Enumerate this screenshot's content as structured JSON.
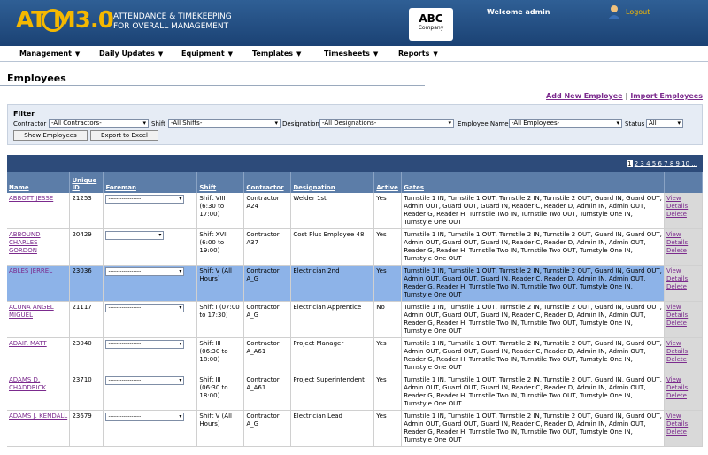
{
  "header": {
    "logo_text": "AT  M3.0",
    "tagline_line1": "ATTENDANCE & TIMEKEEPING",
    "tagline_line2": "FOR OVERALL MANAGEMENT",
    "company_name": "ABC",
    "company_sub": "Company",
    "welcome": "Welcome admin",
    "logout": "Logout"
  },
  "menu": [
    {
      "label": "Management"
    },
    {
      "label": "Daily Updates"
    },
    {
      "label": "Equipment"
    },
    {
      "label": "Templates"
    },
    {
      "label": "Timesheets"
    },
    {
      "label": "Reports"
    }
  ],
  "page_title": "Employees",
  "links": {
    "add": "Add New Employee",
    "sep": "|",
    "import": "Import Employees"
  },
  "filter": {
    "title": "Filter",
    "contractor_label": "Contractor",
    "contractor_value": "-All Contractors-",
    "shift_label": "Shift",
    "shift_value": "-All Shifts-",
    "designation_label": "Designation",
    "designation_value": "-All Designations-",
    "employee_label": "Employee Name",
    "employee_value": "-All Employees-",
    "status_label": "Status",
    "status_value": "All",
    "show_btn": "Show Employees",
    "export_btn": "Export to Excel"
  },
  "pager": {
    "current": "1",
    "pages": "2 3 4 5 6 7 8 9 10 ..."
  },
  "columns": [
    "Name",
    "Unique ID",
    "Foreman",
    "Shift",
    "Contractor",
    "Designation",
    "Active",
    "Gates",
    ""
  ],
  "foreman_value": "-----------------",
  "gates_text": "Turnstile 1 IN, Turnstile 1 OUT, Turnstile 2 IN, Turnstile 2 OUT, Guard IN, Guard OUT, Admin OUT, Guard OUT, Guard IN, Reader C, Reader D, Admin IN, Admin OUT, Reader G, Reader H, Turnstile Two IN, Turnstile Two OUT, Turnstyle One IN, Turnstyle One OUT",
  "actions": {
    "view": "View",
    "details": "Details",
    "delete": "Delete"
  },
  "rows": [
    {
      "name": "ABBOTT JESSE",
      "id": "21253",
      "shift": "Shift VIII (6:30 to 17:00)",
      "contractor": "Contractor A24",
      "designation": "Welder 1st",
      "active": "Yes"
    },
    {
      "name": "ABBOUND CHARLES GORDON",
      "id": "20429",
      "shift": "Shift XVII (6:00 to 19:00)",
      "contractor": "Contractor A37",
      "designation": "Cost Plus Employee 48",
      "active": "Yes"
    },
    {
      "name": "ABLES JERREL",
      "id": "23036",
      "shift": "Shift V (All Hours)",
      "contractor": "Contractor A_G",
      "designation": "Electrician 2nd",
      "active": "Yes"
    },
    {
      "name": "ACUNA ANGEL MIGUEL",
      "id": "21117",
      "shift": "Shift I (07:00 to 17:30)",
      "contractor": "Contractor A_G",
      "designation": "Electrician Apprentice",
      "active": "No"
    },
    {
      "name": "ADAIR MATT",
      "id": "23040",
      "shift": "Shift III (06:30 to 18:00)",
      "contractor": "Contractor A_A61",
      "designation": "Project Manager",
      "active": "Yes"
    },
    {
      "name": "ADAMS D. CHADDRICK",
      "id": "23710",
      "shift": "Shift III (06:30 to 18:00)",
      "contractor": "Contractor A_A61",
      "designation": "Project Superintendent",
      "active": "Yes"
    },
    {
      "name": "ADAMS J. KENDALL",
      "id": "23679",
      "shift": "Shift V (All Hours)",
      "contractor": "Contractor A_G",
      "designation": "Electrician Lead",
      "active": "Yes"
    }
  ]
}
